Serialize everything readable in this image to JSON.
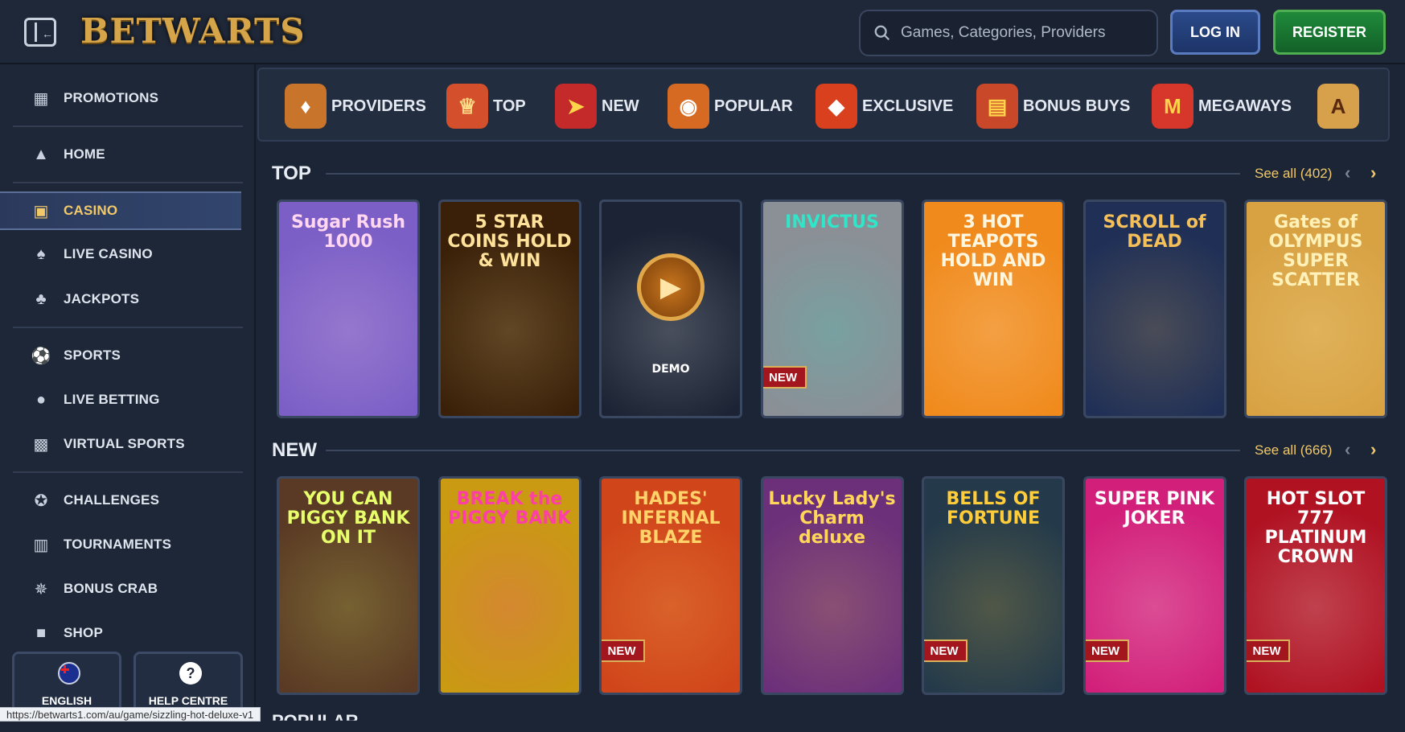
{
  "header": {
    "logo_text": "BETWARTS",
    "search_placeholder": "Games, Categories, Providers",
    "login_label": "LOG IN",
    "register_label": "REGISTER"
  },
  "sidebar": {
    "items": [
      {
        "label": "PROMOTIONS",
        "icon": "gift-box-icon"
      },
      {
        "label": "HOME",
        "icon": "wizard-hat-icon"
      },
      {
        "label": "CASINO",
        "icon": "slot-machine-icon",
        "active": true
      },
      {
        "label": "LIVE CASINO",
        "icon": "live-cards-icon"
      },
      {
        "label": "JACKPOTS",
        "icon": "clover-icon"
      },
      {
        "label": "SPORTS",
        "icon": "soccer-ball-icon"
      },
      {
        "label": "LIVE BETTING",
        "icon": "live-betting-icon"
      },
      {
        "label": "VIRTUAL SPORTS",
        "icon": "gamepad-icon"
      },
      {
        "label": "CHALLENGES",
        "icon": "medal-icon"
      },
      {
        "label": "TOURNAMENTS",
        "icon": "podium-icon"
      },
      {
        "label": "BONUS CRAB",
        "icon": "crab-claw-icon"
      },
      {
        "label": "SHOP",
        "icon": "shopping-bag-icon"
      }
    ],
    "footer": {
      "language_label": "ENGLISH",
      "help_label": "HELP CENTRE",
      "help_icon_glyph": "?"
    }
  },
  "categories": [
    {
      "label": "PROVIDERS",
      "icon": "providers-book-icon",
      "color": "#c8742a"
    },
    {
      "label": "TOP",
      "icon": "crown-icon",
      "color": "#d4502c"
    },
    {
      "label": "NEW",
      "icon": "lightning-icon",
      "color": "#c42a2a"
    },
    {
      "label": "POPULAR",
      "icon": "fire-orb-icon",
      "color": "#d66a22"
    },
    {
      "label": "EXCLUSIVE",
      "icon": "ruby-icon",
      "color": "#d8401e"
    },
    {
      "label": "BONUS BUYS",
      "icon": "bonus-chest-icon",
      "color": "#c9482a"
    },
    {
      "label": "MEGAWAYS",
      "icon": "megaways-m-icon",
      "color": "#d6372a"
    },
    {
      "label": "",
      "icon": "card-ace-icon",
      "color": "#d7a04a"
    }
  ],
  "sections": {
    "top": {
      "title": "TOP",
      "see_all": "See all (402)",
      "games": [
        {
          "title": "Sugar Rush 1000",
          "bg": "#7b5fc6",
          "fg": "#ffd7f0",
          "badge": ""
        },
        {
          "title": "5 STAR COINS HOLD & WIN",
          "bg": "#3a2008",
          "fg": "#ffe29a",
          "badge": ""
        },
        {
          "title": "DEMO",
          "bg": "#1b2334",
          "fg": "#ffffff",
          "badge": ""
        },
        {
          "title": "INVICTUS",
          "bg": "#8b8f96",
          "fg": "#2fe6c8",
          "badge": "NEW"
        },
        {
          "title": "3 HOT TEAPOTS HOLD AND WIN",
          "bg": "#f08a1c",
          "fg": "#fff6e0",
          "badge": ""
        },
        {
          "title": "SCROLL of DEAD",
          "bg": "#1f2f56",
          "fg": "#f5c05a",
          "badge": ""
        },
        {
          "title": "Gates of OLYMPUS SUPER SCATTER",
          "bg": "#d8a243",
          "fg": "#fff1b8",
          "badge": ""
        }
      ]
    },
    "new": {
      "title": "NEW",
      "see_all": "See all (666)",
      "games": [
        {
          "title": "YOU CAN PIGGY BANK ON IT",
          "bg": "#5a3a24",
          "fg": "#e7ff6a",
          "badge": ""
        },
        {
          "title": "BREAK the PIGGY BANK",
          "bg": "#c99a12",
          "fg": "#ff3ea8",
          "badge": ""
        },
        {
          "title": "HADES' INFERNAL BLAZE",
          "bg": "#d0451a",
          "fg": "#ffd36a",
          "badge": "NEW"
        },
        {
          "title": "Lucky Lady's Charm deluxe",
          "bg": "#6c2f7a",
          "fg": "#ffd65a",
          "badge": ""
        },
        {
          "title": "BELLS OF FORTUNE",
          "bg": "#243a4a",
          "fg": "#ffcc3a",
          "badge": "NEW"
        },
        {
          "title": "SUPER PINK JOKER",
          "bg": "#d2207a",
          "fg": "#ffffff",
          "badge": "NEW"
        },
        {
          "title": "HOT SLOT 777 PLATINUM CROWN",
          "bg": "#b01222",
          "fg": "#ffffff",
          "badge": "NEW"
        }
      ]
    },
    "popular_peek": "POPULAR"
  },
  "status_url": "https://betwarts1.com/au/game/sizzling-hot-deluxe-v1"
}
